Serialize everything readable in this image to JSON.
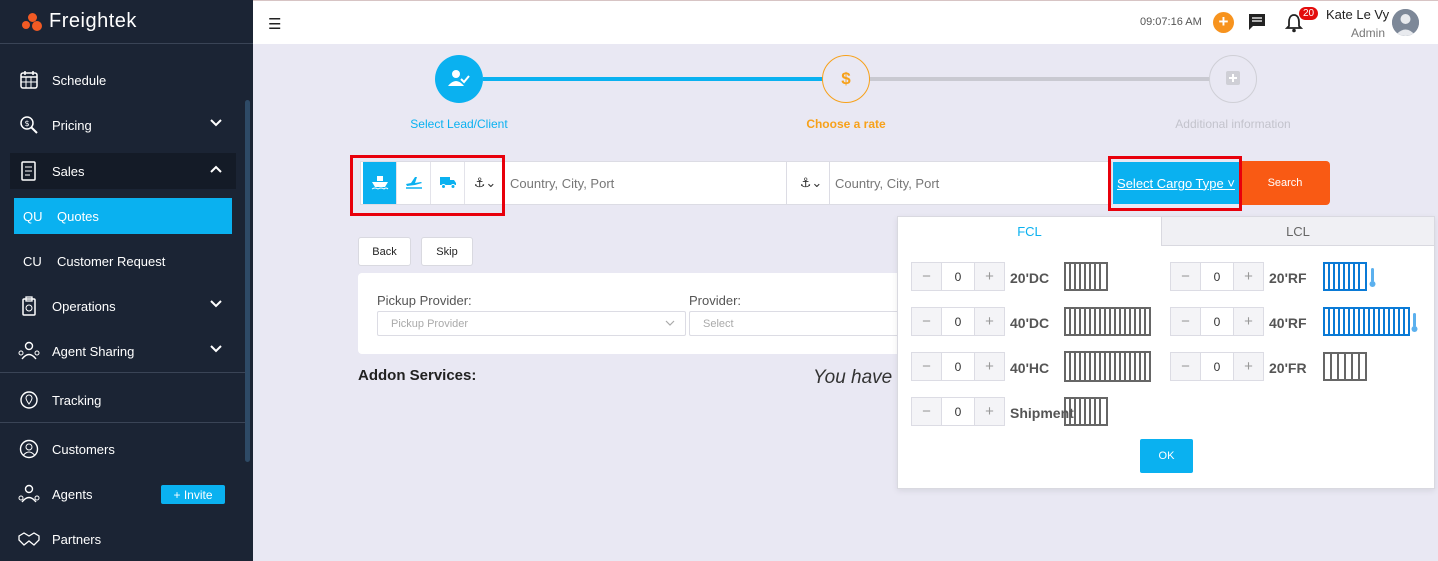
{
  "brand": {
    "name": "Freightek"
  },
  "sidebar": {
    "items": {
      "schedule": "Schedule",
      "pricing": "Pricing",
      "sales": "Sales",
      "quotes_abbr": "QU",
      "quotes": "Quotes",
      "customer_request_abbr": "CU",
      "customer_request": "Customer Request",
      "operations": "Operations",
      "agent_sharing": "Agent Sharing",
      "tracking": "Tracking",
      "customers": "Customers",
      "agents": "Agents",
      "partners": "Partners"
    },
    "invite_label": "+ Invite"
  },
  "header": {
    "time": "09:07:16 AM",
    "notification_count": "20",
    "user_name": "Kate Le Vy",
    "user_role": "Admin"
  },
  "stepper": {
    "step1": "Select Lead/Client",
    "step2": "Choose a rate",
    "step2_symbol": "$",
    "step3": "Additional information"
  },
  "search": {
    "origin_placeholder": "Country, City, Port",
    "destination_placeholder": "Country, City, Port",
    "cargo_type_label": "Select Cargo Type ˅",
    "search_label": "Search",
    "port_icon": "⚓︎⌄"
  },
  "actions": {
    "back": "Back",
    "skip": "Skip"
  },
  "providers": {
    "pickup_label": "Pickup Provider:",
    "pickup_placeholder": "Pickup Provider",
    "provider_label": "Provider:",
    "provider_placeholder": "Select"
  },
  "addon": {
    "title": "Addon Services:",
    "you_have": "You have"
  },
  "cargo_panel": {
    "tabs": {
      "fcl": "FCL",
      "lcl": "LCL"
    },
    "rows": [
      {
        "type": "20'DC",
        "value": "0"
      },
      {
        "type": "40'DC",
        "value": "0"
      },
      {
        "type": "40'HC",
        "value": "0"
      },
      {
        "type": "Shipment",
        "value": "0"
      },
      {
        "type": "20'RF",
        "value": "0"
      },
      {
        "type": "40'RF",
        "value": "0"
      },
      {
        "type": "20'FR",
        "value": "0"
      }
    ],
    "ok_label": "OK"
  },
  "colors": {
    "accent": "#0ab1f0",
    "orange": "#f95a14",
    "highlight": "#e8000b",
    "sidebar": "#1b2434"
  }
}
